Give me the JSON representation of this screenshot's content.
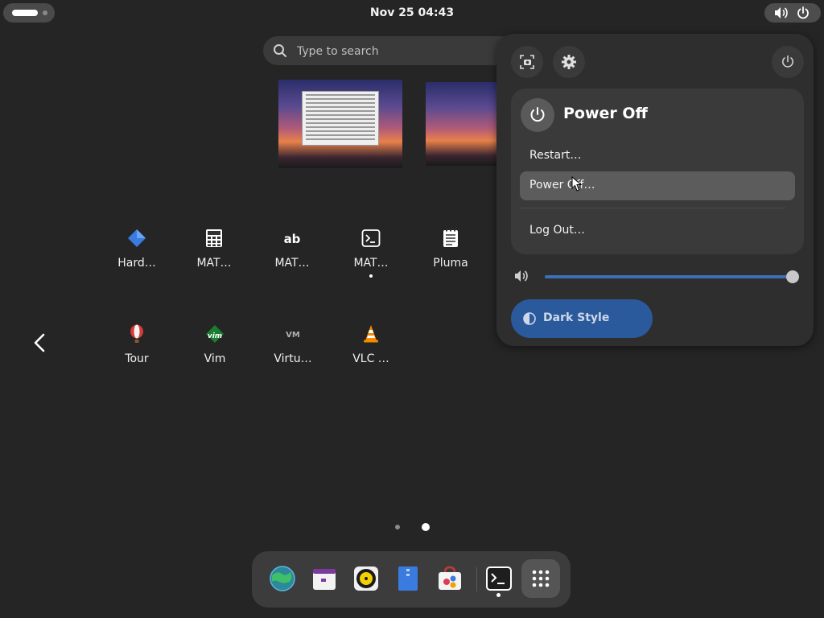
{
  "topbar": {
    "clock": "Nov 25  04:43"
  },
  "search": {
    "placeholder": "Type to search"
  },
  "apps": [
    {
      "name": "Hard…",
      "icon": "hardinfo-diamond-icon",
      "running": false
    },
    {
      "name": "MAT…",
      "icon": "calculator-icon",
      "running": false
    },
    {
      "name": "MAT…",
      "icon": "character-map-icon",
      "running": false
    },
    {
      "name": "MAT…",
      "icon": "terminal-icon",
      "running": true
    },
    {
      "name": "Pluma",
      "icon": "text-editor-icon",
      "running": false
    },
    {
      "name": "Tour",
      "icon": "tour-balloon-icon",
      "running": false
    },
    {
      "name": "Vim",
      "icon": "vim-icon",
      "running": false
    },
    {
      "name": "Virtu…",
      "icon": "virtualbox-icon",
      "running": false
    },
    {
      "name": "VLC …",
      "icon": "vlc-cone-icon",
      "running": false
    }
  ],
  "pager": {
    "pages": 2,
    "current": 2
  },
  "dash": {
    "items": [
      "browser-globe-icon",
      "calendar-icon",
      "music-player-icon",
      "file-manager-icon",
      "software-store-icon",
      "terminal-icon",
      "app-grid-icon"
    ]
  },
  "quick_settings": {
    "power_menu": {
      "title": "Power Off",
      "items": {
        "restart": "Restart…",
        "power_off": "Power Off…",
        "log_out": "Log Out…"
      }
    },
    "volume_level": 1.0,
    "dark_style": {
      "label": "Dark Style",
      "active": true
    }
  },
  "colors": {
    "accent": "#2a5a9c",
    "background": "#252525",
    "panel": "#2e2e2e"
  }
}
